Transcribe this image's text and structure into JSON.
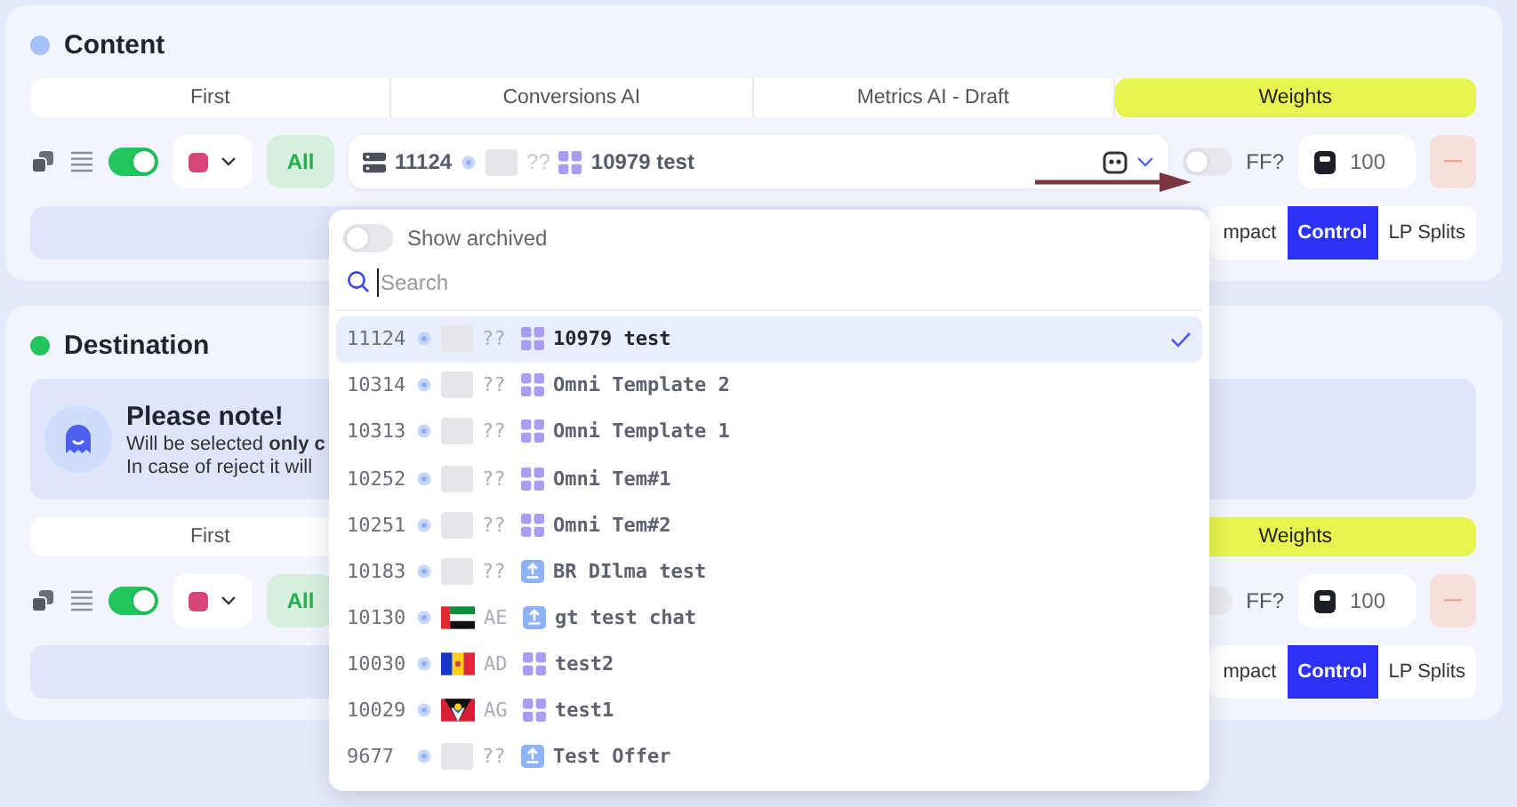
{
  "sections": [
    {
      "title": "Content",
      "color": "#a6c0fa",
      "tabs": [
        {
          "label": "First",
          "selected": false
        },
        {
          "label": "Conversions AI",
          "selected": false
        },
        {
          "label": "Metrics AI - Draft",
          "selected": false
        },
        {
          "label": "Weights",
          "selected": true
        }
      ],
      "row": {
        "enabled": true,
        "filter": "All",
        "selector": {
          "id": "11124",
          "code": "??",
          "name": "10979 test"
        },
        "ff": false,
        "ff_label": "FF?",
        "weight": "100"
      },
      "modes": [
        {
          "label": "mpact",
          "selected": false
        },
        {
          "label": "Control",
          "selected": true
        },
        {
          "label": "LP Splits",
          "selected": false
        }
      ]
    },
    {
      "title": "Destination",
      "color": "#22c55e",
      "note": {
        "title": "Please note!",
        "lines": [
          "Will be selected **only c**",
          "In case of reject it will"
        ]
      },
      "tabs": [
        {
          "label": "First",
          "selected": false
        },
        {
          "label": "Weights",
          "selected": true
        }
      ],
      "row": {
        "enabled": true,
        "filter": "All",
        "ff": false,
        "ff_label": "FF?",
        "weight": "100"
      },
      "modes": [
        {
          "label": "mpact",
          "selected": false
        },
        {
          "label": "Control",
          "selected": true
        },
        {
          "label": "LP Splits",
          "selected": false
        }
      ]
    }
  ],
  "dropdown": {
    "show_archived": {
      "label": "Show archived",
      "on": false
    },
    "search_placeholder": "Search",
    "items": [
      {
        "id": "11124",
        "code": "??",
        "kind": "grid",
        "name": "10979 test",
        "selected": true
      },
      {
        "id": "10314",
        "code": "??",
        "kind": "grid",
        "name": "Omni Template 2",
        "selected": false
      },
      {
        "id": "10313",
        "code": "??",
        "kind": "grid",
        "name": "Omni Template 1",
        "selected": false
      },
      {
        "id": "10252",
        "code": "??",
        "kind": "grid",
        "name": "Omni Tem#1",
        "selected": false
      },
      {
        "id": "10251",
        "code": "??",
        "kind": "grid",
        "name": "Omni Tem#2",
        "selected": false
      },
      {
        "id": "10183",
        "code": "??",
        "kind": "upload",
        "name": "BR DIlma test",
        "selected": false
      },
      {
        "id": "10130",
        "flag": {
          "kind": "ae"
        },
        "code": "AE",
        "kind": "upload",
        "name": "gt test chat",
        "selected": false
      },
      {
        "id": "10030",
        "flag": {
          "kind": "ad"
        },
        "code": "AD",
        "kind": "grid",
        "name": "test2",
        "selected": false
      },
      {
        "id": "10029",
        "flag": {
          "kind": "ag"
        },
        "code": "AG",
        "kind": "grid",
        "name": "test1",
        "selected": false
      },
      {
        "id": "9677",
        "code": "??",
        "kind": "upload",
        "name": "Test Offer",
        "selected": false
      }
    ]
  }
}
